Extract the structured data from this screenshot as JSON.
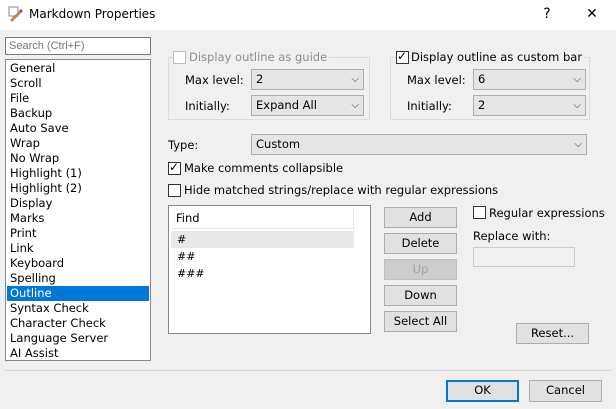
{
  "window": {
    "title": "Markdown Properties",
    "help_label": "?",
    "close_label": "✕"
  },
  "search": {
    "placeholder": "Search (Ctrl+F)"
  },
  "categories": {
    "items": [
      "General",
      "Scroll",
      "File",
      "Backup",
      "Auto Save",
      "Wrap",
      "No Wrap",
      "Highlight (1)",
      "Highlight (2)",
      "Display",
      "Marks",
      "Print",
      "Link",
      "Keyboard",
      "Spelling",
      "Outline",
      "Syntax Check",
      "Character Check",
      "Language Server",
      "AI Assist"
    ],
    "selected": "Outline"
  },
  "outline_guide": {
    "checkbox_label": "Display outline as guide",
    "checked": false,
    "enabled": false,
    "max_level_label": "Max level:",
    "max_level_value": "2",
    "initially_label": "Initially:",
    "initially_value": "Expand All"
  },
  "outline_bar": {
    "checkbox_label": "Display outline as custom bar",
    "checked": true,
    "max_level_label": "Max level:",
    "max_level_value": "6",
    "initially_label": "Initially:",
    "initially_value": "2"
  },
  "type": {
    "label": "Type:",
    "value": "Custom"
  },
  "options": {
    "collapsible_label": "Make comments collapsible",
    "collapsible_checked": true,
    "hide_matched_label": "Hide matched strings/replace with regular expressions",
    "hide_matched_checked": false
  },
  "find_list": {
    "header": "Find",
    "items": [
      "#",
      "##",
      "###"
    ]
  },
  "buttons": {
    "add": "Add",
    "delete": "Delete",
    "up": "Up",
    "down": "Down",
    "select_all": "Select All",
    "reset": "Reset...",
    "ok": "OK",
    "cancel": "Cancel"
  },
  "regex": {
    "checkbox_label": "Regular expressions",
    "checked": false,
    "replace_label": "Replace with:",
    "replace_value": ""
  },
  "colors": {
    "selection": "#0078d7",
    "dialog_bg": "#f0f0f0",
    "primary_border": "#0078d7"
  }
}
